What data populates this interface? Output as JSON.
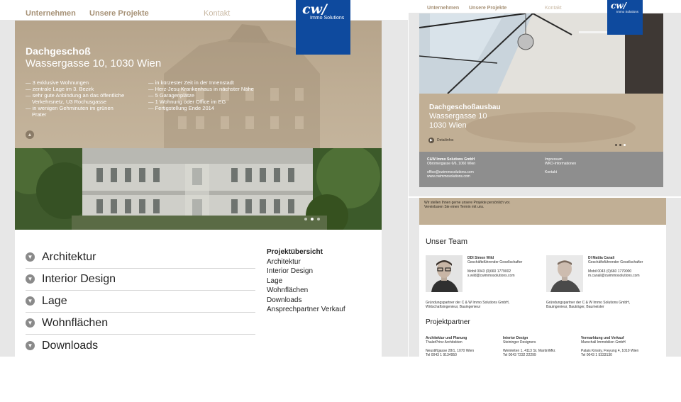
{
  "left": {
    "nav": {
      "item1": "Unternehmen",
      "item2": "Unsere Projekte",
      "item3": "Kontakt"
    },
    "logo": {
      "mark": "cw/",
      "sub": "Immo Solutions",
      "color": "#0e4a9e"
    },
    "hero": {
      "title": "Dachgeschoß",
      "address": "Wassergasse 10, 1030 Wien",
      "bullets_left": [
        "— 3 exklusive Wohnungen",
        "— zentrale Lage im 3. Bezirk",
        "— sehr gute Anbindung an das öffentliche",
        "    Verkehrsnetz, U3 Rochusgasse",
        "— in wenigen Gehminuten im grünen",
        "    Prater"
      ],
      "bullets_right": [
        "— in kürzester Zeit in der Innenstadt",
        "— Herz-Jesu Krankenhaus in nächster Nähe",
        "— 5 Garagenplätze",
        "— 1 Wohnung oder Office im EG",
        "— Fertigstellung Ende 2014"
      ],
      "collapse_icon": "chevron-up-icon"
    },
    "accordion": [
      "Architektur",
      "Interior Design",
      "Lage",
      "Wohnflächen",
      "Downloads"
    ],
    "sidebar": {
      "title": "Projektübersicht",
      "links": [
        "Architektur",
        "Interior Design",
        "Lage",
        "Wohnflächen",
        "Downloads",
        "Ansprechpartner Verkauf"
      ]
    }
  },
  "right_top": {
    "nav": {
      "item1": "Unternehmen",
      "item2": "Unsere Projekte",
      "item3": "Kontakt"
    },
    "logo": {
      "mark": "cw/",
      "sub": "Immo Solutions"
    },
    "hero": {
      "title": "Dachgeschoßausbau",
      "line1": "Wassergasse 10",
      "line2": "1030 Wien",
      "link": "Detailinfos"
    },
    "footer": {
      "company": "C&W Immo Solutions GmbH",
      "street": "Obromergasse 6/6, 1060 Wien",
      "email": "office@cwimmosolutions.com",
      "web": "www.cwimmosolutions.com",
      "link1": "Impressum",
      "link2": "WKO-Informationen",
      "link3": "Kontakt"
    }
  },
  "right_bottom": {
    "intro1": "Wir stellen Ihnen gerne unsere Projekte persönlich vor.",
    "intro2": "Vereinbaren Sie einen Termin mit uns.",
    "team_title": "Unser Team",
    "person1": {
      "name": "DDI Simon Wild",
      "role": "Geschäftsführender Gesellschafter",
      "phone": "Mobil 0043 (0)660 1779002",
      "email": "s.wild@cwimmosolutions.com",
      "bio1": "Gründungspartner der C & W Immo Solutions GmbH,",
      "bio2": "Wirtschaftsingenieur, Bauingenieur"
    },
    "person2": {
      "name": "DI Mattia Canali",
      "role": "Geschäftsführender Gesellschafter",
      "phone": "Mobil 0043 (0)660 1779000",
      "email": "m.canali@cwimmosolutions.com",
      "bio1": "Gründungspartner der C & W Immo Solutions GmbH,",
      "bio2": "Bauingenieur, Bauträger, Baumeister"
    },
    "partners_title": "Projektpartner",
    "partners": [
      {
        "role": "Architektur und Planung",
        "name": "ThalerPrinz Architekten",
        "addr": "Neustiftgasse 28/1, 1070 Wien",
        "tel": "Tel 0043 1 9134950"
      },
      {
        "role": "Interior Design",
        "name": "Steininger Designers",
        "addr": "Weinleiten 1, 4113 St. Martin/Mkr.",
        "tel": "Tel 0043 7232 22299"
      },
      {
        "role": "Vermarktung und Verkauf",
        "name": "Marschall Immobilien GmbH",
        "addr": "Palais Kinsky, Freyung 4, 1010 Wien",
        "tel": "Tel 0043 1 5333130"
      }
    ]
  }
}
